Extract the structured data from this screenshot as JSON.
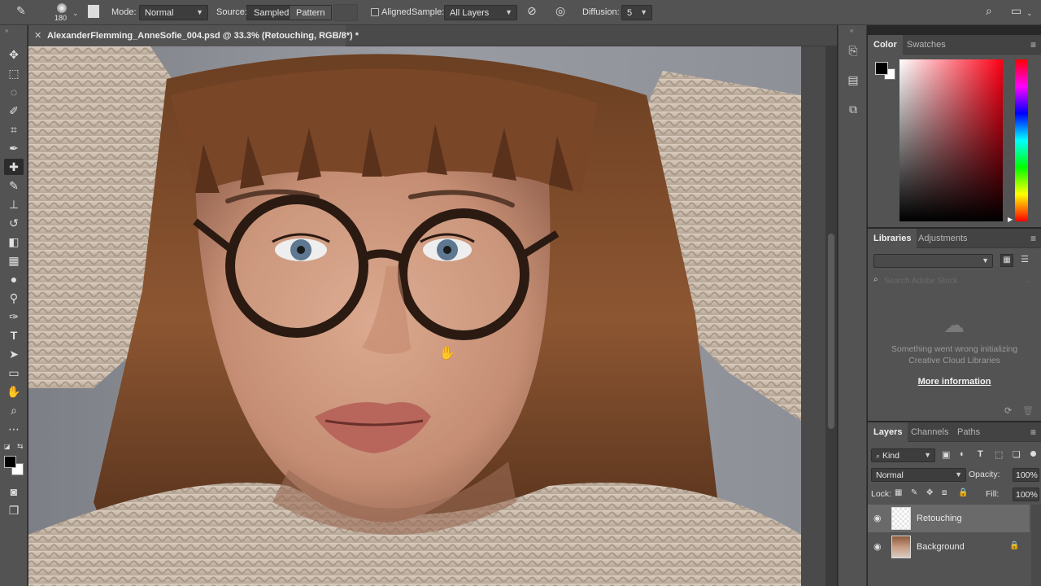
{
  "options_bar": {
    "brush_size": "180",
    "mode_label": "Mode:",
    "mode_value": "Normal",
    "source_label": "Source:",
    "source_sampled": "Sampled",
    "source_pattern": "Pattern",
    "aligned_label": "Aligned",
    "sample_label": "Sample:",
    "sample_value": "All Layers",
    "diffusion_label": "Diffusion:",
    "diffusion_value": "5"
  },
  "document": {
    "tab_title": "AlexanderFlemming_AnneSofie_004.psd @ 33.3% (Retouching, RGB/8*) *"
  },
  "color_panel": {
    "tabs": [
      "Color",
      "Swatches"
    ],
    "foreground": "#000000",
    "background": "#ffffff"
  },
  "libraries_panel": {
    "tabs": [
      "Libraries",
      "Adjustments"
    ],
    "search_placeholder": "Search Adobe Stock",
    "error_line1": "Something went wrong initializing",
    "error_line2": "Creative Cloud Libraries",
    "more_info": "More information"
  },
  "layers_panel": {
    "tabs": [
      "Layers",
      "Channels",
      "Paths"
    ],
    "filter_kind": "Kind",
    "blend_mode": "Normal",
    "opacity_label": "Opacity:",
    "opacity_value": "100%",
    "lock_label": "Lock:",
    "fill_label": "Fill:",
    "fill_value": "100%",
    "layers": [
      {
        "name": "Retouching",
        "selected": true
      },
      {
        "name": "Background",
        "selected": false
      }
    ]
  }
}
